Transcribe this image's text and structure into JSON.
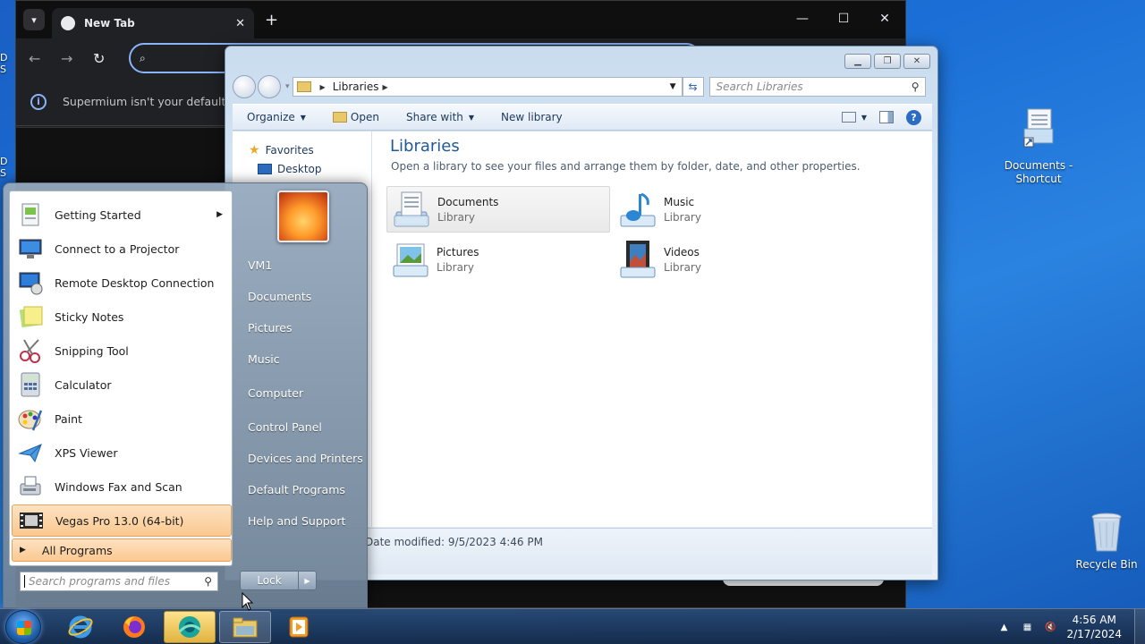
{
  "desktop": {
    "edge_text_1": "D S",
    "edge_text_2": "D S",
    "icons": [
      {
        "label": "Documents - Shortcut"
      },
      {
        "label": "Recycle Bin"
      }
    ]
  },
  "browser": {
    "tab_title": "New Tab",
    "infobar_text": "Supermium isn't your default br"
  },
  "explorer": {
    "breadcrumb": "Libraries",
    "search_placeholder": "Search Libraries",
    "toolbar": {
      "organize": "Organize",
      "open": "Open",
      "share_with": "Share with",
      "new_library": "New library"
    },
    "nav": {
      "favorites": "Favorites",
      "desktop": "Desktop"
    },
    "heading": "Libraries",
    "subheading": "Open a library to see your files and arrange them by folder, date, and other properties.",
    "libraries": [
      {
        "name": "Documents",
        "type": "Library"
      },
      {
        "name": "Music",
        "type": "Library"
      },
      {
        "name": "Pictures",
        "type": "Library"
      },
      {
        "name": "Videos",
        "type": "Library"
      }
    ],
    "details": "Date modified: 9/5/2023 4:46 PM"
  },
  "start_menu": {
    "programs": [
      {
        "label": "Getting Started"
      },
      {
        "label": "Connect to a Projector"
      },
      {
        "label": "Remote Desktop Connection"
      },
      {
        "label": "Sticky Notes"
      },
      {
        "label": "Snipping Tool"
      },
      {
        "label": "Calculator"
      },
      {
        "label": "Paint"
      },
      {
        "label": "XPS Viewer"
      },
      {
        "label": "Windows Fax and Scan"
      },
      {
        "label": "Vegas Pro 13.0 (64-bit)"
      }
    ],
    "all_programs": "All Programs",
    "search_placeholder": "Search programs and files",
    "right_links": [
      {
        "label": "VM1"
      },
      {
        "label": "Documents"
      },
      {
        "label": "Pictures"
      },
      {
        "label": "Music"
      },
      {
        "label": "Computer"
      },
      {
        "label": "Control Panel"
      },
      {
        "label": "Devices and Printers"
      },
      {
        "label": "Default Programs"
      },
      {
        "label": "Help and Support"
      }
    ],
    "lock": "Lock"
  },
  "taskbar": {
    "time": "4:56 AM",
    "date": "2/17/2024"
  }
}
